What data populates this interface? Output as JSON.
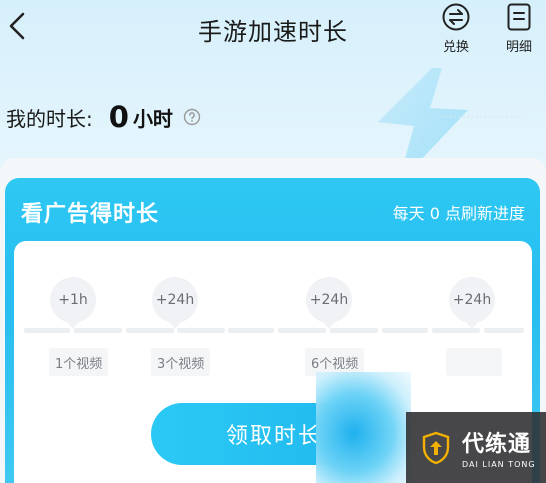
{
  "header": {
    "title": "手游加速时长",
    "exchange_label": "兑换",
    "detail_label": "明细"
  },
  "duration": {
    "label": "我的时长:",
    "value": "0",
    "unit": "小时"
  },
  "card": {
    "title": "看广告得时长",
    "note": "每天 0 点刷新进度",
    "milestones": [
      {
        "reward": "+1h",
        "requirement": "1个视频"
      },
      {
        "reward": "+24h",
        "requirement": "3个视频"
      },
      {
        "reward": "+24h",
        "requirement": "6个视频"
      },
      {
        "reward": "+24h",
        "requirement": ""
      }
    ],
    "claim_label": "领取时长"
  },
  "watermark": {
    "text": "代练通",
    "subtext": "DAI LIAN TONG"
  },
  "colors": {
    "accent": "#27bdf0",
    "button": "#1fb6ee"
  }
}
